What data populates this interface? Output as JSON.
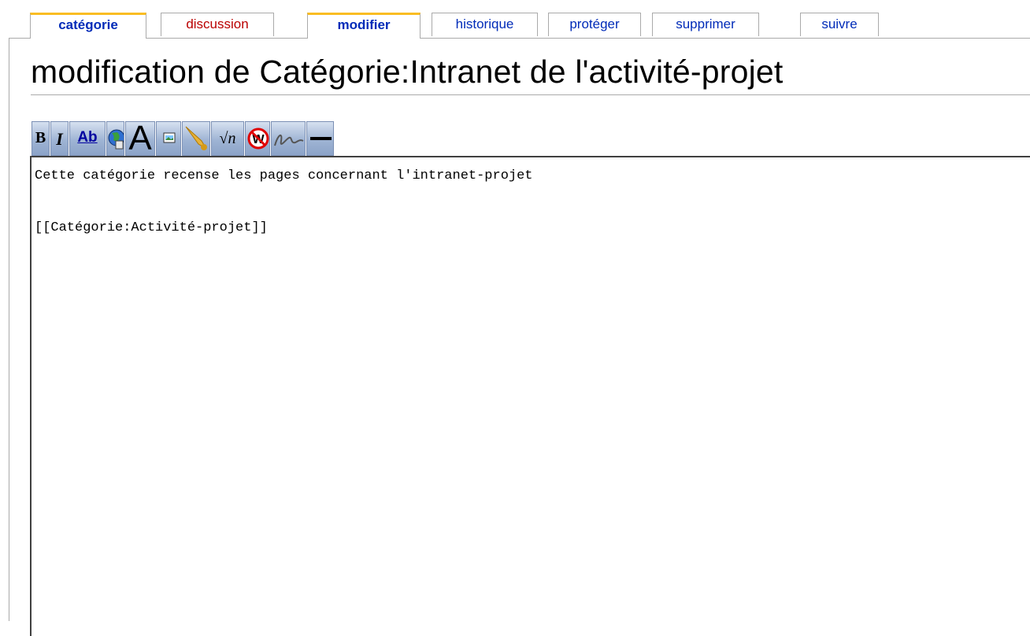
{
  "tabs": [
    {
      "label": "catégorie",
      "state": "selected"
    },
    {
      "label": "discussion",
      "state": "new"
    },
    {
      "label": "modifier",
      "state": "selected"
    },
    {
      "label": "historique",
      "state": "normal"
    },
    {
      "label": "protéger",
      "state": "normal"
    },
    {
      "label": "supprimer",
      "state": "normal"
    },
    {
      "label": "suivre",
      "state": "normal"
    }
  ],
  "page": {
    "title": "modification de Catégorie:Intranet de l'activité-projet"
  },
  "toolbar": {
    "bold_label": "B",
    "italic_label": "I",
    "internal_link_label": "Ab",
    "headline_label": "A",
    "math_label": "√n",
    "buttons": [
      "bold-icon",
      "italic-icon",
      "internal-link-icon",
      "external-link-icon",
      "headline-icon",
      "image-icon",
      "media-icon",
      "math-icon",
      "nowiki-icon",
      "signature-icon",
      "horizontal-line-icon"
    ]
  },
  "editor": {
    "lines": [
      "Cette catégorie recense les pages concernant l'intranet-projet",
      "",
      "[[Catégorie:Activité-projet]]"
    ]
  },
  "colors": {
    "tab_selected_accent": "#fabd23",
    "link": "#002bb8",
    "new_link": "#ba0000",
    "toolbar_blue": "#9fb4d4"
  }
}
